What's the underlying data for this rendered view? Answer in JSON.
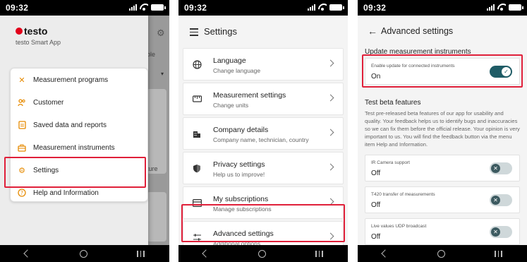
{
  "status_time": "09:32",
  "screen1": {
    "logo_text": "testo",
    "app_name": "testo Smart App",
    "background_tab_fragment": "ble",
    "background_text_fragment": "ture",
    "menu": [
      {
        "label": "Measurement programs",
        "icon": "tools-icon"
      },
      {
        "label": "Customer",
        "icon": "customer-icon"
      },
      {
        "label": "Saved data and reports",
        "icon": "document-icon"
      },
      {
        "label": "Measurement instruments",
        "icon": "toolbox-icon"
      },
      {
        "label": "Settings",
        "icon": "gear-icon"
      },
      {
        "label": "Help and Information",
        "icon": "help-icon"
      }
    ]
  },
  "screen2": {
    "title": "Settings",
    "items": [
      {
        "title": "Language",
        "subtitle": "Change language",
        "icon": "globe-icon"
      },
      {
        "title": "Measurement settings",
        "subtitle": "Change units",
        "icon": "ruler-icon"
      },
      {
        "title": "Company details",
        "subtitle": "Company name, technician, country",
        "icon": "building-icon"
      },
      {
        "title": "Privacy settings",
        "subtitle": "Help us to improve!",
        "icon": "shield-icon"
      },
      {
        "title": "My subscriptions",
        "subtitle": "Manage subscriptions",
        "icon": "subscription-icon"
      },
      {
        "title": "Advanced settings",
        "subtitle": "Additional options",
        "icon": "sliders-icon"
      }
    ]
  },
  "screen3": {
    "title": "Advanced settings",
    "update_section_title": "Update measurement instruments",
    "update_card": {
      "label": "Enable update for connected instruments",
      "value": "On",
      "toggle_on": true
    },
    "beta_section_title": "Test beta features",
    "beta_description": "Test pre-released beta features of our app for usability and quality. Your feedback helps us to identify bugs and inaccuracies so we can fix them before the official release. Your opinion is very important to us. You will find the feedback button via the menu item Help and Information.",
    "beta_features": [
      {
        "label": "IR Camera support",
        "value": "Off",
        "toggle_on": false
      },
      {
        "label": "T420 transfer of measurements",
        "value": "Off",
        "toggle_on": false
      },
      {
        "label": "Live values UDP broadcast",
        "value": "Off",
        "toggle_on": false
      }
    ]
  },
  "colors": {
    "highlight": "#e0203a",
    "toggle_on": "#1f5c66",
    "brand_red": "#e2001a",
    "menu_icon": "#e68a00"
  }
}
